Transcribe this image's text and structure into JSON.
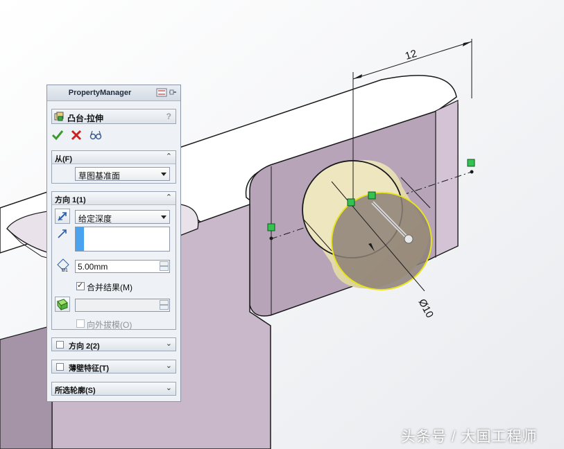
{
  "viewport": {
    "dimension_top": "12",
    "dimension_diameter": "Ø10"
  },
  "property_manager": {
    "header_title": "PropertyManager",
    "feature_title": "凸台-拉伸",
    "help": "?",
    "from_group": {
      "label": "从(F)",
      "start_condition": "草图基准面"
    },
    "direction1_group": {
      "label": "方向 1(1)",
      "end_condition": "给定深度",
      "depth_value": "5.00mm",
      "merge_result_label": "合并结果(M)",
      "merge_result_checked": true,
      "draft_value": "",
      "draft_outward_label": "向外拔模(O)"
    },
    "direction2_group": {
      "label": "方向 2(2)"
    },
    "thin_feature_group": {
      "label": "薄壁特征(T)"
    },
    "selected_contours_group": {
      "label": "所选轮廓(S)"
    }
  },
  "watermark": "头条号 / 大国工程师",
  "colors": {
    "part_face": "#c4b2c6",
    "part_top": "#ffffff",
    "boss_preview": "#ece4b4",
    "accept_green": "#3c9a2c",
    "cancel_red": "#cc2020"
  }
}
